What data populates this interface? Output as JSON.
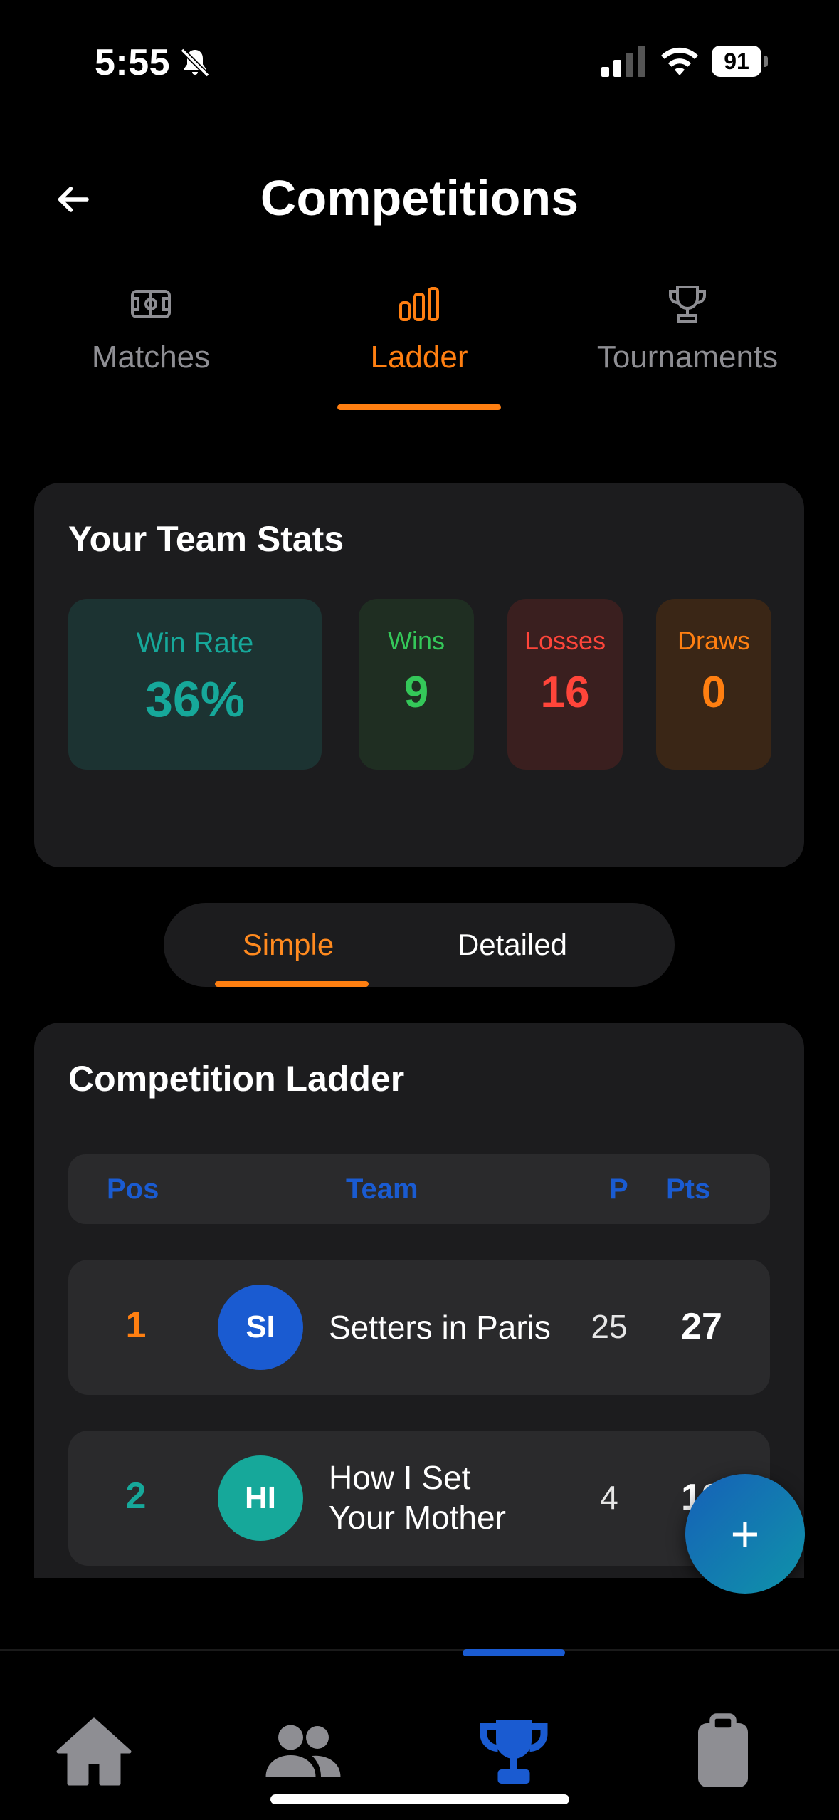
{
  "status_bar": {
    "time": "5:55",
    "battery": "91"
  },
  "header": {
    "title": "Competitions"
  },
  "tabs": [
    {
      "label": "Matches",
      "icon": "field-icon",
      "active": false
    },
    {
      "label": "Ladder",
      "icon": "bar-chart-icon",
      "active": true
    },
    {
      "label": "Tournaments",
      "icon": "trophy-icon",
      "active": false
    }
  ],
  "team_stats": {
    "title": "Your Team Stats",
    "win_rate": {
      "label": "Win Rate",
      "value": "36%",
      "color": "#16a89a"
    },
    "wins": {
      "label": "Wins",
      "value": "9",
      "color": "#34c759"
    },
    "losses": {
      "label": "Losses",
      "value": "16",
      "color": "#ff453a"
    },
    "draws": {
      "label": "Draws",
      "value": "0",
      "color": "#ff7f11"
    }
  },
  "view_toggle": {
    "simple": "Simple",
    "detailed": "Detailed",
    "selected": "Simple"
  },
  "ladder": {
    "title": "Competition Ladder",
    "columns": {
      "pos": "Pos",
      "team": "Team",
      "played": "P",
      "points": "Pts"
    },
    "rows": [
      {
        "pos": "1",
        "initials": "SI",
        "team": "Setters in Paris",
        "played": "25",
        "points": "27",
        "avatar_color": "#1a5bd1",
        "pos_color": "#ff7f11"
      },
      {
        "pos": "2",
        "initials": "HI",
        "team_line1": "How I Set",
        "team_line2": "Your Mother",
        "played": "4",
        "points": "12",
        "avatar_color": "#16a89a",
        "pos_color": "#16a89a"
      }
    ]
  },
  "fab": {
    "label": "+"
  },
  "bottom_nav": [
    {
      "icon": "home-icon",
      "active": false
    },
    {
      "icon": "people-icon",
      "active": false
    },
    {
      "icon": "trophy-icon",
      "active": true
    },
    {
      "icon": "clipboard-icon",
      "active": false
    }
  ],
  "colors": {
    "accent": "#ff7f11",
    "primary_blue": "#1a5bd1"
  }
}
